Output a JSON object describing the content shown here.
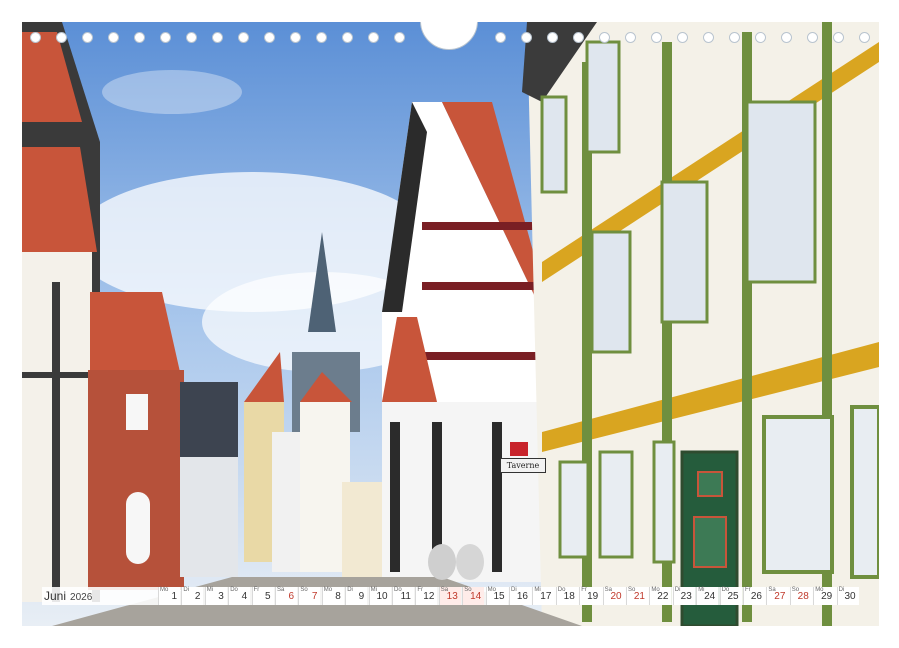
{
  "calendar": {
    "month": "Juni",
    "year": "2026",
    "days": [
      {
        "n": "1",
        "w": "Mo",
        "type": "normal"
      },
      {
        "n": "2",
        "w": "Di",
        "type": "normal"
      },
      {
        "n": "3",
        "w": "Mi",
        "type": "normal"
      },
      {
        "n": "4",
        "w": "Do",
        "type": "normal"
      },
      {
        "n": "5",
        "w": "Fr",
        "type": "normal"
      },
      {
        "n": "6",
        "w": "Sa",
        "type": "sun"
      },
      {
        "n": "7",
        "w": "So",
        "type": "sun"
      },
      {
        "n": "8",
        "w": "Mo",
        "type": "normal"
      },
      {
        "n": "9",
        "w": "Di",
        "type": "normal"
      },
      {
        "n": "10",
        "w": "Mi",
        "type": "normal"
      },
      {
        "n": "11",
        "w": "Do",
        "type": "normal"
      },
      {
        "n": "12",
        "w": "Fr",
        "type": "normal"
      },
      {
        "n": "13",
        "w": "Sa",
        "type": "hol"
      },
      {
        "n": "14",
        "w": "So",
        "type": "hol"
      },
      {
        "n": "15",
        "w": "Mo",
        "type": "normal"
      },
      {
        "n": "16",
        "w": "Di",
        "type": "normal"
      },
      {
        "n": "17",
        "w": "Mi",
        "type": "normal"
      },
      {
        "n": "18",
        "w": "Do",
        "type": "normal"
      },
      {
        "n": "19",
        "w": "Fr",
        "type": "normal"
      },
      {
        "n": "20",
        "w": "Sa",
        "type": "sun"
      },
      {
        "n": "21",
        "w": "So",
        "type": "sun"
      },
      {
        "n": "22",
        "w": "Mo",
        "type": "normal"
      },
      {
        "n": "23",
        "w": "Di",
        "type": "normal"
      },
      {
        "n": "24",
        "w": "Mi",
        "type": "normal"
      },
      {
        "n": "25",
        "w": "Do",
        "type": "normal"
      },
      {
        "n": "26",
        "w": "Fr",
        "type": "normal"
      },
      {
        "n": "27",
        "w": "Sa",
        "type": "sun"
      },
      {
        "n": "28",
        "w": "So",
        "type": "sun"
      },
      {
        "n": "29",
        "w": "Mo",
        "type": "normal"
      },
      {
        "n": "30",
        "w": "Di",
        "type": "normal"
      }
    ]
  },
  "signs": {
    "taverne": "Taverne"
  },
  "colors": {
    "sky": "#8fb8e6",
    "green_house": "#6f8f3f",
    "yellow_beam": "#d9a520",
    "red_roof": "#c8553a",
    "brick": "#b6513a"
  }
}
